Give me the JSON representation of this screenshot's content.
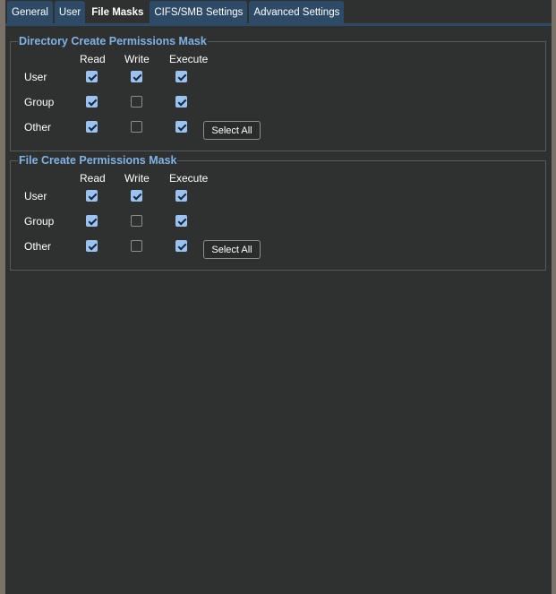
{
  "tabs": [
    "General",
    "User",
    "File Masks",
    "CIFS/SMB Settings",
    "Advanced Settings"
  ],
  "active_tab": "File Masks",
  "column_headers": {
    "read": "Read",
    "write": "Write",
    "execute": "Execute"
  },
  "row_labels": {
    "user": "User",
    "group": "Group",
    "other": "Other"
  },
  "directory_mask": {
    "title": "Directory Create Permissions Mask",
    "select_all_label": "Select All",
    "permissions": {
      "user": {
        "read": true,
        "write": true,
        "execute": true
      },
      "group": {
        "read": true,
        "write": false,
        "execute": true
      },
      "other": {
        "read": true,
        "write": false,
        "execute": true
      }
    }
  },
  "file_mask": {
    "title": "File Create Permissions Mask",
    "select_all_label": "Select All",
    "permissions": {
      "user": {
        "read": true,
        "write": true,
        "execute": true
      },
      "group": {
        "read": true,
        "write": false,
        "execute": true
      },
      "other": {
        "read": true,
        "write": false,
        "execute": true
      }
    }
  },
  "colors": {
    "tab_bg": "#2d4a66",
    "panel_bg": "#2f3131",
    "legend": "#7fb2e6",
    "checkbox_checked": "#9cc3f0"
  }
}
